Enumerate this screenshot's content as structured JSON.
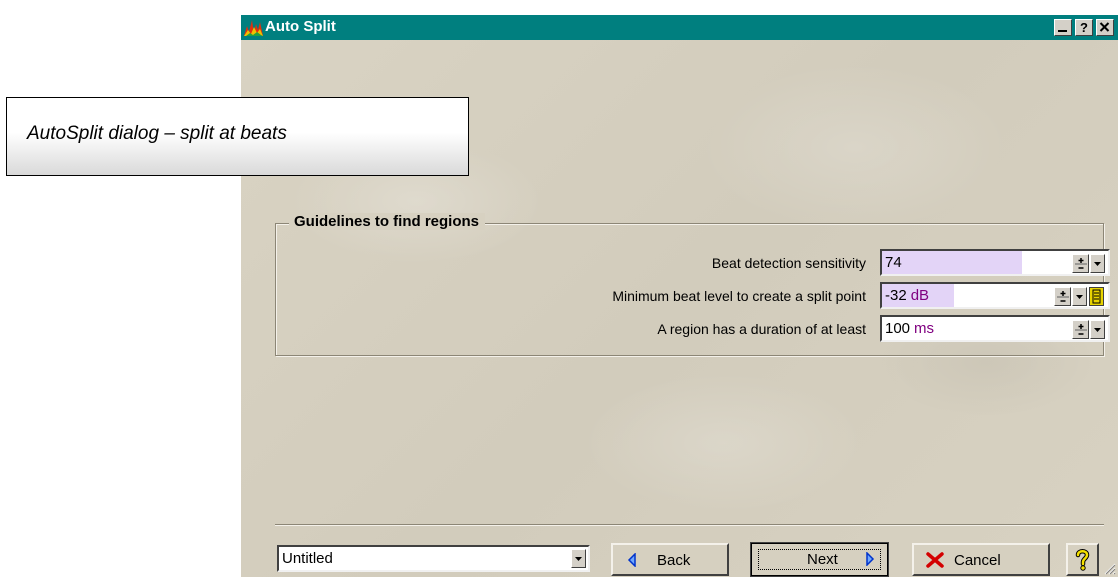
{
  "window": {
    "title": "Auto Split",
    "controls": {
      "minimize": "–",
      "help": "?",
      "close": "×"
    }
  },
  "callout": {
    "text": "AutoSplit dialog – split at beats"
  },
  "group": {
    "title": "Guidelines to find regions",
    "rows": [
      {
        "label": "Beat detection sensitivity",
        "value": "74",
        "unit": "",
        "fill_fraction": 0.62,
        "has_meter": false
      },
      {
        "label": "Minimum beat level to create a split point",
        "value": "-32",
        "unit": "dB",
        "fill_fraction": 0.32,
        "has_meter": true
      },
      {
        "label": "A region has a duration of at least",
        "value": "100",
        "unit": "ms",
        "fill_fraction": 0,
        "has_meter": false
      }
    ]
  },
  "footer": {
    "preset_value": "Untitled",
    "back_label": "Back",
    "next_label": "Next",
    "cancel_label": "Cancel",
    "help_label": "?"
  },
  "icons": {
    "app": "waveform-app-icon",
    "back": "triangle-left-icon",
    "next": "triangle-right-icon",
    "cancel": "red-x-icon",
    "help": "yellow-question-icon",
    "meter": "level-meter-icon"
  },
  "colors": {
    "titlebar": "#007f7f",
    "slider_fill": "#e3d4f7",
    "unit_text": "#800080",
    "cancel_x": "#d40000",
    "nav_arrow": "#0033cc"
  }
}
